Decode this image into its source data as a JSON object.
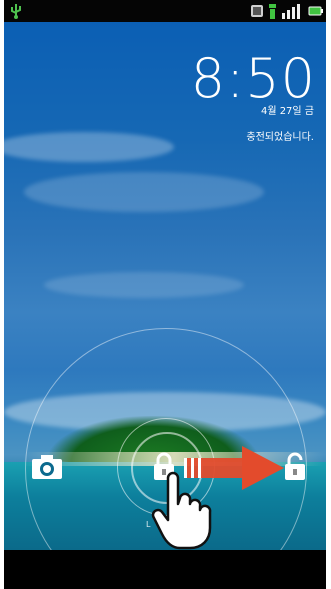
{
  "clock": {
    "time": "8:50",
    "date": "4월 27일 금",
    "charging_status": "충전되었습니다."
  },
  "lock_label": "L",
  "colors": {
    "accent_arrow": "#e34b2c",
    "signal_green": "#41c341"
  },
  "icons": [
    "usb-icon",
    "sim-icon",
    "signal-icon",
    "battery-icon",
    "camera-icon",
    "lock-icon",
    "unlock-icon",
    "hand-pointer-icon",
    "arrow-right-icon"
  ]
}
